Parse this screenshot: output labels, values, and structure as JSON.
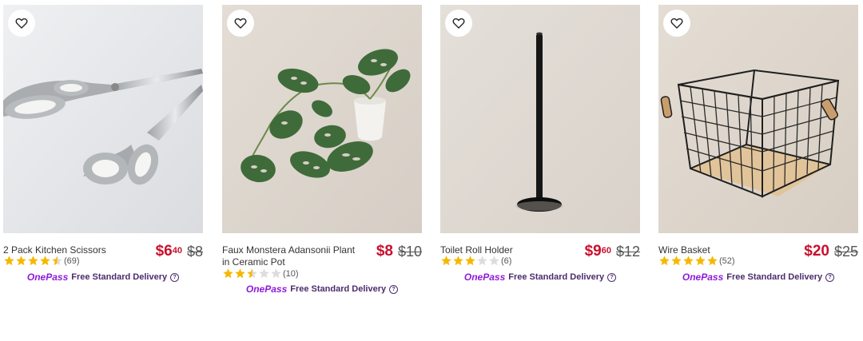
{
  "delivery": {
    "brand": "OnePass",
    "label": "Free Standard Delivery",
    "help_glyph": "?"
  },
  "products": [
    {
      "title": "2 Pack Kitchen Scissors",
      "price_dollars": "$6",
      "price_cents": "40",
      "was_price": "$8",
      "rating": 4.5,
      "review_count": "(69)",
      "image_icon": "kitchen-scissors-image"
    },
    {
      "title": "Faux Monstera Adansonii Plant in Ceramic Pot",
      "price_dollars": "$8",
      "price_cents": "",
      "was_price": "$10",
      "rating": 2.5,
      "review_count": "(10)",
      "image_icon": "monstera-plant-image"
    },
    {
      "title": "Toilet Roll Holder",
      "price_dollars": "$9",
      "price_cents": "60",
      "was_price": "$12",
      "rating": 3,
      "review_count": "(6)",
      "image_icon": "toilet-roll-holder-image"
    },
    {
      "title": "Wire Basket",
      "price_dollars": "$20",
      "price_cents": "",
      "was_price": "$25",
      "rating": 5,
      "review_count": "(52)",
      "image_icon": "wire-basket-image"
    }
  ],
  "colors": {
    "sale_price": "#c8102e",
    "star_filled": "#f5b800",
    "star_empty": "#dddddd",
    "onepass": "#8c1bdb"
  },
  "icons": {
    "wishlist": "heart-outline-icon",
    "star": "star-icon",
    "help": "question-circle-icon"
  }
}
